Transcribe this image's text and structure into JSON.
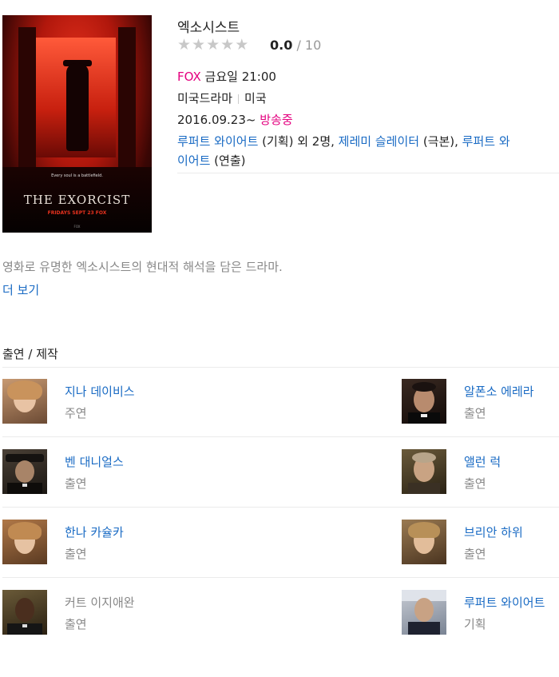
{
  "show": {
    "title": "엑소시스트",
    "rating": {
      "stars_filled": 0,
      "stars_total": 5,
      "score": "0.0",
      "separator": "/",
      "max": "10"
    },
    "channel": "FOX",
    "airtime": "금요일 21:00",
    "genre": "미국드라마",
    "country": "미국",
    "premiere": "2016.09.23~",
    "status": "방송중",
    "credits": {
      "p1": "루퍼트 와이어트",
      "p1_role": " (기획) 외 2명, ",
      "p2": "제레미 슬레이터",
      "p2_role": " (극본), ",
      "p3_a": "루퍼트 와",
      "p3_b": "이어트",
      "p3_role": " (연출)"
    }
  },
  "poster": {
    "tagline": "Every soul is a battlefield.",
    "title": "THE EXORCIST",
    "date": "FRIDAYS SEPT 23 FOX",
    "footer": "FOX"
  },
  "synopsis": "영화로 유명한 엑소시스트의 현대적 해석을 담은 드라마.",
  "more_label": "더 보기",
  "cast_heading": "출연 / 제작",
  "cast": [
    {
      "name": "지나 데이비스",
      "role": "주연",
      "linked": true
    },
    {
      "name": "알폰소 에레라",
      "role": "출연",
      "linked": true
    },
    {
      "name": "벤 대니얼스",
      "role": "출연",
      "linked": true
    },
    {
      "name": "앨런 럭",
      "role": "출연",
      "linked": true
    },
    {
      "name": "한나 카슐카",
      "role": "출연",
      "linked": true
    },
    {
      "name": "브리안 하위",
      "role": "출연",
      "linked": true
    },
    {
      "name": "커트 이지애완",
      "role": "출연",
      "linked": false
    },
    {
      "name": "루퍼트 와이어트",
      "role": "기획",
      "linked": true
    }
  ],
  "colors": {
    "link": "#1a6bc4",
    "accent": "#e4007f",
    "muted": "#888888"
  }
}
